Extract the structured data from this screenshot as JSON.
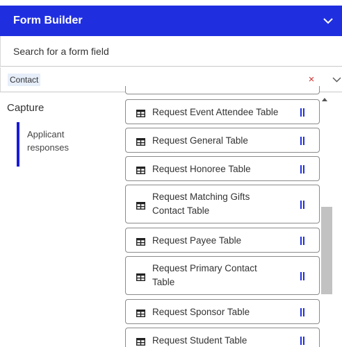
{
  "header": {
    "title": "Form Builder"
  },
  "search": {
    "placeholder": "Search for a form field"
  },
  "filter": {
    "tag": "Contact",
    "clear_symbol": "×"
  },
  "nav": {
    "section": "Capture",
    "items": [
      {
        "label_line1": "Applicant",
        "label_line2": "responses"
      }
    ]
  },
  "fields": [
    {
      "line1": "Request Event Attendee Table",
      "line2": ""
    },
    {
      "line1": "Request General Table",
      "line2": ""
    },
    {
      "line1": "Request Honoree Table",
      "line2": ""
    },
    {
      "line1": "Request Matching Gifts",
      "line2": "Contact Table"
    },
    {
      "line1": "Request Payee Table",
      "line2": ""
    },
    {
      "line1": "Request Primary Contact",
      "line2": "Table"
    },
    {
      "line1": "Request Sponsor Table",
      "line2": ""
    },
    {
      "line1": "Request Student Table",
      "line2": ""
    }
  ],
  "colors": {
    "header_bg": "#1f2fe0",
    "accent": "#1a1adb",
    "clear": "#d32f2f",
    "tag_bg": "#e6eefa"
  },
  "icons": {
    "field": "table-icon",
    "handle": "drag-handle-icon",
    "collapse": "chevron-down-icon"
  }
}
